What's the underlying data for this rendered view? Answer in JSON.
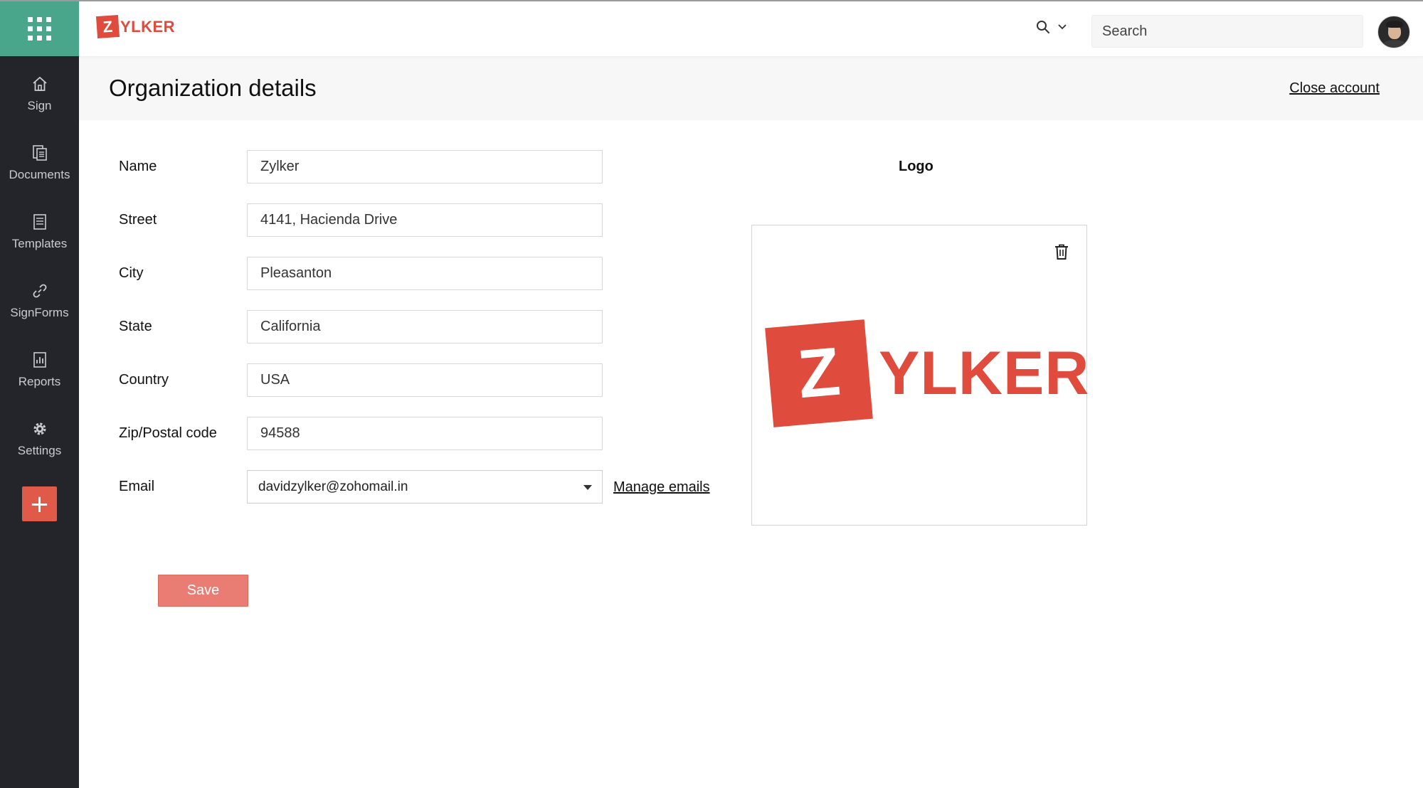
{
  "brand": {
    "logo_mark": "Z",
    "logo_text": "YLKER",
    "accent": "#df4b3c",
    "apps_bg": "#4aa68a"
  },
  "topbar": {
    "search_placeholder": "Search",
    "search_scope_icon": "search-icon"
  },
  "sidebar": {
    "items": [
      {
        "label": "Sign",
        "icon": "home-icon"
      },
      {
        "label": "Documents",
        "icon": "documents-icon"
      },
      {
        "label": "Templates",
        "icon": "templates-icon"
      },
      {
        "label": "SignForms",
        "icon": "link-icon"
      },
      {
        "label": "Reports",
        "icon": "reports-icon"
      },
      {
        "label": "Settings",
        "icon": "gear-icon"
      }
    ],
    "add_label": "+"
  },
  "page": {
    "title": "Organization details",
    "close_account": "Close account"
  },
  "form": {
    "name": {
      "label": "Name",
      "value": "Zylker"
    },
    "street": {
      "label": "Street",
      "value": "4141, Hacienda Drive"
    },
    "city": {
      "label": "City",
      "value": "Pleasanton"
    },
    "state": {
      "label": "State",
      "value": "California"
    },
    "country": {
      "label": "Country",
      "value": "USA"
    },
    "zip": {
      "label": "Zip/Postal code",
      "value": "94588"
    },
    "email": {
      "label": "Email",
      "value": "davidzylker@zohomail.in",
      "manage": "Manage emails"
    },
    "save_label": "Save"
  },
  "logo": {
    "label": "Logo",
    "mark": "Z",
    "text": "YLKER"
  }
}
